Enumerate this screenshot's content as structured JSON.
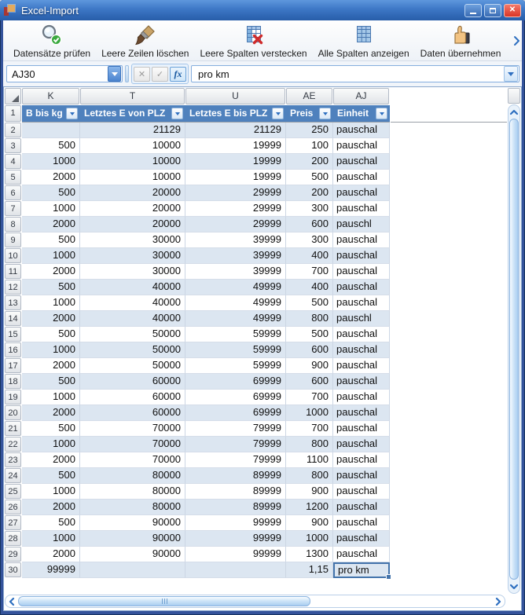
{
  "window": {
    "title": "Excel-Import",
    "controls": [
      "minimize",
      "maximize",
      "close"
    ]
  },
  "toolbar": {
    "buttons": [
      {
        "label": "Datensätze prüfen",
        "icon": "magnifier-check-icon"
      },
      {
        "label": "Leere Zeilen löschen",
        "icon": "brush-icon"
      },
      {
        "label": "Leere Spalten verstecken",
        "icon": "table-hide-icon"
      },
      {
        "label": "Alle Spalten anzeigen",
        "icon": "table-show-icon"
      },
      {
        "label": "Daten übernehmen",
        "icon": "thumbs-up-icon"
      }
    ]
  },
  "formula_bar": {
    "cell_reference": "AJ30",
    "value": "pro km",
    "buttons": [
      {
        "name": "cancel",
        "glyph": "✕"
      },
      {
        "name": "confirm",
        "glyph": "✓"
      },
      {
        "name": "insert-function",
        "glyph": "fx"
      }
    ]
  },
  "grid": {
    "column_headers": [
      "K",
      "T",
      "U",
      "AE",
      "AJ"
    ],
    "filter_row_number": 1,
    "filter_headers": [
      "B bis kg",
      "Letztes E von PLZ",
      "Letztes E bis PLZ",
      "Preis",
      "Einheit"
    ],
    "selected_cell": "AJ30",
    "rows": [
      {
        "n": 2,
        "cells": [
          "",
          "21129",
          "21129",
          "250",
          "pauschal"
        ]
      },
      {
        "n": 3,
        "cells": [
          "500",
          "10000",
          "19999",
          "100",
          "pauschal"
        ]
      },
      {
        "n": 4,
        "cells": [
          "1000",
          "10000",
          "19999",
          "200",
          "pauschal"
        ]
      },
      {
        "n": 5,
        "cells": [
          "2000",
          "10000",
          "19999",
          "500",
          "pauschal"
        ]
      },
      {
        "n": 6,
        "cells": [
          "500",
          "20000",
          "29999",
          "200",
          "pauschal"
        ]
      },
      {
        "n": 7,
        "cells": [
          "1000",
          "20000",
          "29999",
          "300",
          "pauschal"
        ]
      },
      {
        "n": 8,
        "cells": [
          "2000",
          "20000",
          "29999",
          "600",
          "pauschl"
        ]
      },
      {
        "n": 9,
        "cells": [
          "500",
          "30000",
          "39999",
          "300",
          "pauschal"
        ]
      },
      {
        "n": 10,
        "cells": [
          "1000",
          "30000",
          "39999",
          "400",
          "pauschal"
        ]
      },
      {
        "n": 11,
        "cells": [
          "2000",
          "30000",
          "39999",
          "700",
          "pauschal"
        ]
      },
      {
        "n": 12,
        "cells": [
          "500",
          "40000",
          "49999",
          "400",
          "pauschal"
        ]
      },
      {
        "n": 13,
        "cells": [
          "1000",
          "40000",
          "49999",
          "500",
          "pauschal"
        ]
      },
      {
        "n": 14,
        "cells": [
          "2000",
          "40000",
          "49999",
          "800",
          "pauschl"
        ]
      },
      {
        "n": 15,
        "cells": [
          "500",
          "50000",
          "59999",
          "500",
          "pauschal"
        ]
      },
      {
        "n": 16,
        "cells": [
          "1000",
          "50000",
          "59999",
          "600",
          "pauschal"
        ]
      },
      {
        "n": 17,
        "cells": [
          "2000",
          "50000",
          "59999",
          "900",
          "pauschal"
        ]
      },
      {
        "n": 18,
        "cells": [
          "500",
          "60000",
          "69999",
          "600",
          "pauschal"
        ]
      },
      {
        "n": 19,
        "cells": [
          "1000",
          "60000",
          "69999",
          "700",
          "pauschal"
        ]
      },
      {
        "n": 20,
        "cells": [
          "2000",
          "60000",
          "69999",
          "1000",
          "pauschal"
        ]
      },
      {
        "n": 21,
        "cells": [
          "500",
          "70000",
          "79999",
          "700",
          "pauschal"
        ]
      },
      {
        "n": 22,
        "cells": [
          "1000",
          "70000",
          "79999",
          "800",
          "pauschal"
        ]
      },
      {
        "n": 23,
        "cells": [
          "2000",
          "70000",
          "79999",
          "1100",
          "pauschal"
        ]
      },
      {
        "n": 24,
        "cells": [
          "500",
          "80000",
          "89999",
          "800",
          "pauschal"
        ]
      },
      {
        "n": 25,
        "cells": [
          "1000",
          "80000",
          "89999",
          "900",
          "pauschal"
        ]
      },
      {
        "n": 26,
        "cells": [
          "2000",
          "80000",
          "89999",
          "1200",
          "pauschal"
        ]
      },
      {
        "n": 27,
        "cells": [
          "500",
          "90000",
          "99999",
          "900",
          "pauschal"
        ]
      },
      {
        "n": 28,
        "cells": [
          "1000",
          "90000",
          "99999",
          "1000",
          "pauschal"
        ]
      },
      {
        "n": 29,
        "cells": [
          "2000",
          "90000",
          "99999",
          "1300",
          "pauschal"
        ]
      },
      {
        "n": 30,
        "cells": [
          "99999",
          "",
          "",
          "1,15",
          "pro km"
        ],
        "selected_col": 4
      }
    ]
  },
  "colors": {
    "titlebar_blue": "#3d77c6",
    "close_button_red": "#d93527",
    "filter_header_blue": "#4f81bd",
    "alt_row_blue": "#dce6f1",
    "selection_border": "#4373ab"
  }
}
